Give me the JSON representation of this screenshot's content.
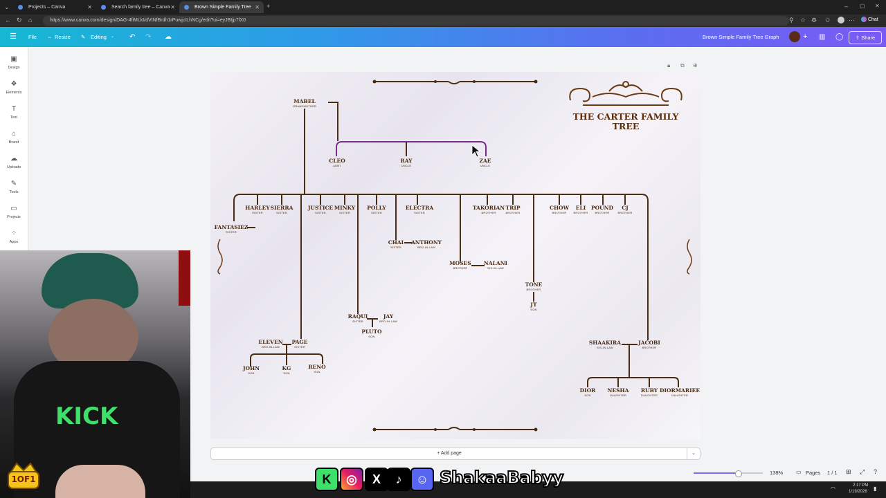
{
  "browser": {
    "tabs": [
      {
        "label": "Projects – Canva"
      },
      {
        "label": "Search family tree – Canva"
      },
      {
        "label": "Brown Simple Family Tree Graph –"
      }
    ],
    "url": "https://www.canva.com/design/DAG-4fiMLkI/dVtNfBrdh1rPuwjcILhNCg/edit?ui=eyJBIjp7fX0",
    "chat_label": "Chat"
  },
  "toolbar": {
    "file": "File",
    "resize": "Resize",
    "editing": "Editing",
    "doc_title": "Brown Simple Family Tree Graph",
    "share": "Share"
  },
  "sidebar": {
    "items": [
      {
        "label": "Design",
        "icon": "design-icon"
      },
      {
        "label": "Elements",
        "icon": "elements-icon"
      },
      {
        "label": "Text",
        "icon": "text-icon"
      },
      {
        "label": "Brand",
        "icon": "brand-icon"
      },
      {
        "label": "Uploads",
        "icon": "uploads-icon"
      },
      {
        "label": "Tools",
        "icon": "tools-icon"
      },
      {
        "label": "Projects",
        "icon": "projects-icon"
      },
      {
        "label": "Apps",
        "icon": "apps-icon"
      }
    ]
  },
  "tree": {
    "title": "THE CARTER FAMILY TREE",
    "people": [
      {
        "name": "MABEL",
        "role": "GRANDMOTHER"
      },
      {
        "name": "CLEO",
        "role": "AUNT"
      },
      {
        "name": "RAY",
        "role": "UNCLE"
      },
      {
        "name": "ZAE",
        "role": "UNCLE"
      },
      {
        "name": "HARLEY",
        "role": "SISTER"
      },
      {
        "name": "SIERRA",
        "role": "SISTER"
      },
      {
        "name": "JUSTICE",
        "role": "SISTER"
      },
      {
        "name": "MINKY",
        "role": "SISTER"
      },
      {
        "name": "POLLY",
        "role": "SISTER"
      },
      {
        "name": "ELECTRA",
        "role": "SISTER"
      },
      {
        "name": "TAKORIAN",
        "role": "BROTHER"
      },
      {
        "name": "TRIP",
        "role": "BROTHER"
      },
      {
        "name": "CHOW",
        "role": "BROTHER"
      },
      {
        "name": "ELI",
        "role": "BROTHER"
      },
      {
        "name": "POUND",
        "role": "BROTHER"
      },
      {
        "name": "CJ",
        "role": "BROTHER"
      },
      {
        "name": "FANTASIEZ",
        "role": "SISTER"
      },
      {
        "name": "CHAI",
        "role": "SISTER"
      },
      {
        "name": "ANTHONY",
        "role": "BRO-IN-LAW"
      },
      {
        "name": "MOSES",
        "role": "BROTHER"
      },
      {
        "name": "NALANI",
        "role": "SIS-IN-LAW"
      },
      {
        "name": "TONE",
        "role": "BROTHER"
      },
      {
        "name": "JT",
        "role": "SON"
      },
      {
        "name": "RAQUI",
        "role": "SISTER"
      },
      {
        "name": "JAY",
        "role": "BRO-IN-LAW"
      },
      {
        "name": "PLUTO",
        "role": "SON"
      },
      {
        "name": "ELEVEN",
        "role": "BRO-IN-LAW"
      },
      {
        "name": "PAGE",
        "role": "SISTER"
      },
      {
        "name": "JOHN",
        "role": "SON"
      },
      {
        "name": "KG",
        "role": "SON"
      },
      {
        "name": "RENO",
        "role": "SON"
      },
      {
        "name": "SHAAKIRA",
        "role": "SIS-IN-LAW"
      },
      {
        "name": "JACOBI",
        "role": "BROTHER"
      },
      {
        "name": "DIOR",
        "role": "SON"
      },
      {
        "name": "NESHA",
        "role": "DAUGHTER"
      },
      {
        "name": "RUBY",
        "role": "DAUGHTER"
      },
      {
        "name": "DIORMARIEE",
        "role": "DAUGHTER"
      }
    ]
  },
  "canvas": {
    "add_page": "+ Add page"
  },
  "bottom": {
    "zoom": "138%",
    "pages_label": "Pages",
    "page_count": "1 / 1"
  },
  "taskbar": {
    "time": "2:17 PM",
    "date": "1/19/2026"
  },
  "overlay": {
    "streamer": "ShakaaBabyy",
    "logo_text": "1OF1",
    "kick_text": "KICK",
    "social_icons": [
      "kick-icon",
      "instagram-icon",
      "x-icon",
      "tiktok-icon",
      "discord-icon"
    ]
  },
  "colors": {
    "tree_brown": "#4a2c12",
    "selection_purple": "#7b2d8e",
    "toolbar_start": "#16b8d3",
    "toolbar_end": "#7a5af5"
  }
}
